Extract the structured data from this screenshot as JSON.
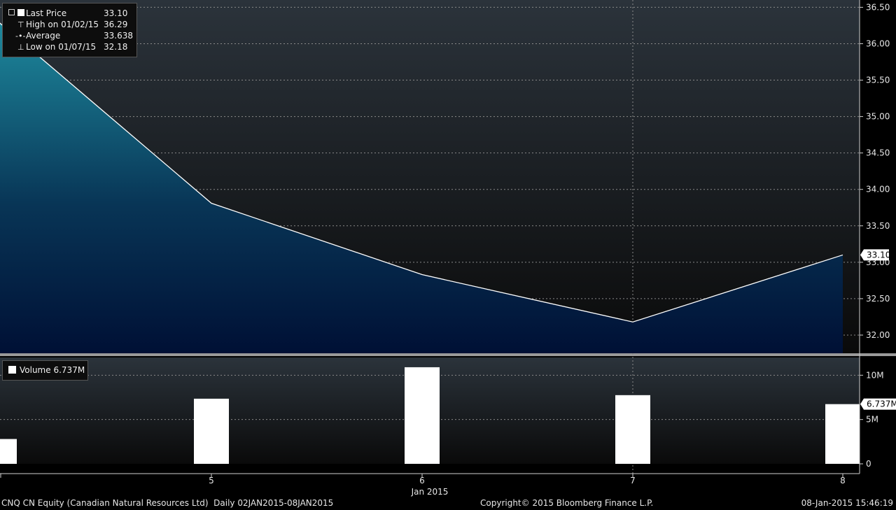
{
  "chart_data": [
    {
      "type": "area",
      "series": [
        {
          "name": "Last Price",
          "x": [
            "02-Jan-2015",
            "05-Jan-2015",
            "06-Jan-2015",
            "07-Jan-2015",
            "08-Jan-2015"
          ],
          "values": [
            36.29,
            33.81,
            32.83,
            32.18,
            33.1
          ]
        }
      ],
      "ylim": [
        31.75,
        36.6
      ],
      "yticks": [
        "32.00",
        "32.50",
        "33.00",
        "33.50",
        "34.00",
        "34.50",
        "35.00",
        "35.50",
        "36.00",
        "36.50"
      ],
      "last_value_label": "33.10",
      "grid": true,
      "legend": [
        {
          "label": "Last Price",
          "value": "33.10"
        },
        {
          "label": "High on 01/02/15",
          "value": "36.29"
        },
        {
          "label": "Average",
          "value": "33.638"
        },
        {
          "label": "Low on 01/07/15",
          "value": "32.18"
        }
      ],
      "legend_position": "top-left"
    },
    {
      "type": "bar",
      "series": [
        {
          "name": "Volume",
          "x": [
            "02-Jan-2015",
            "05-Jan-2015",
            "06-Jan-2015",
            "07-Jan-2015",
            "08-Jan-2015"
          ],
          "values": [
            2.8,
            7.35,
            10.9,
            7.75,
            6.737
          ],
          "unit": "M"
        }
      ],
      "ylim": [
        0,
        12
      ],
      "yticks": [
        "0",
        "5M",
        "10M"
      ],
      "last_value_label": "6.737M",
      "legend": [
        {
          "label": "Volume",
          "value": "6.737M"
        }
      ],
      "legend_position": "top-left"
    }
  ],
  "x_axis": {
    "ticks": [
      "5",
      "6",
      "7",
      "8"
    ],
    "month_label": "Jan 2015"
  },
  "footer": {
    "left": "CNQ CN Equity (Canadian Natural Resources Ltd)  Daily 02JAN2015-08JAN2015",
    "center": "Copyright© 2015 Bloomberg Finance L.P.",
    "right": "08-Jan-2015 15:46:19"
  },
  "colors": {
    "price_line": "#ffffff",
    "area_top": "#1e8a9e",
    "area_bottom": "#001035",
    "volume_bar": "#ffffff",
    "grid": "#8a8a8a",
    "background_top": "#2b333b",
    "background_bottom": "#0a0a0a"
  }
}
